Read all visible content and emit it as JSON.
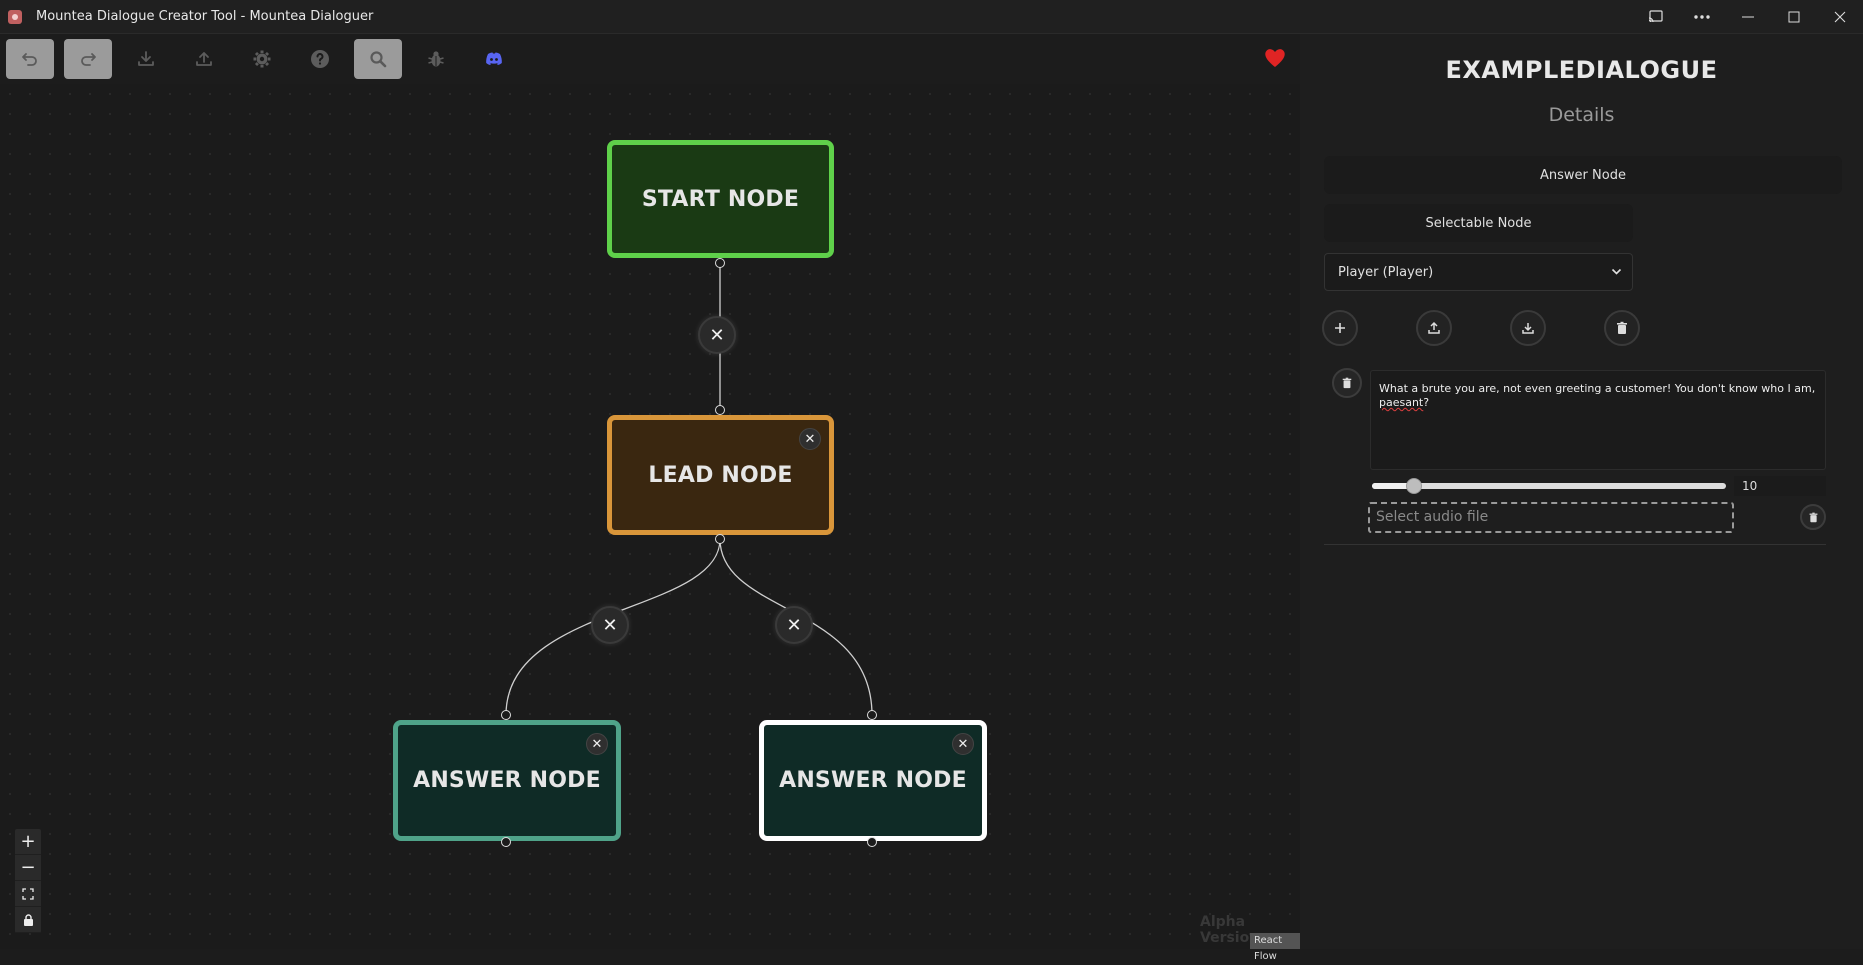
{
  "window": {
    "title": "Mountea Dialogue Creator Tool - Mountea Dialoguer"
  },
  "toolbar": {
    "buttons": [
      "undo-icon",
      "redo-icon",
      "download-icon",
      "upload-icon",
      "gear-icon",
      "help-icon",
      "search-icon",
      "bug-icon",
      "discord-icon"
    ],
    "active": [
      "undo",
      "redo",
      "search"
    ],
    "heart_color": "#e02424"
  },
  "canvas": {
    "nodes": [
      {
        "label": "START NODE",
        "border": "#5fd14a",
        "fill": "#1a3a14"
      },
      {
        "label": "LEAD NODE",
        "border": "#d9963a",
        "fill": "#3a2710"
      },
      {
        "label": "ANSWER NODE",
        "border": "#4fa389",
        "fill": "#0f2b26"
      },
      {
        "label": "ANSWER NODE",
        "border": "#ffffff",
        "fill": "#0f2b26"
      }
    ],
    "edge_button_glyph": "✕",
    "node_close_glyph": "✕",
    "zoom": {
      "in": "+",
      "out": "−",
      "fit": "⛶",
      "lock": "🔒"
    },
    "watermark": "Alpha Version",
    "attribution": "React Flow"
  },
  "panel": {
    "dialogue_name": "EXAMPLEDIALOGUE",
    "details_label": "Details",
    "node_type": "Answer Node",
    "selectable_label": "Selectable Node",
    "participant": "Player (Player)",
    "row_actions": [
      "add-icon",
      "upload-icon",
      "download-icon",
      "trash-icon"
    ],
    "row": {
      "text_main": "What a brute you are, not even greeting a customer! You don't know who I am,",
      "text_misspelled": "paesant",
      "text_end": "?",
      "slider_value": "10",
      "slider_fraction": 0.12,
      "audio_placeholder": "Select audio file"
    }
  }
}
